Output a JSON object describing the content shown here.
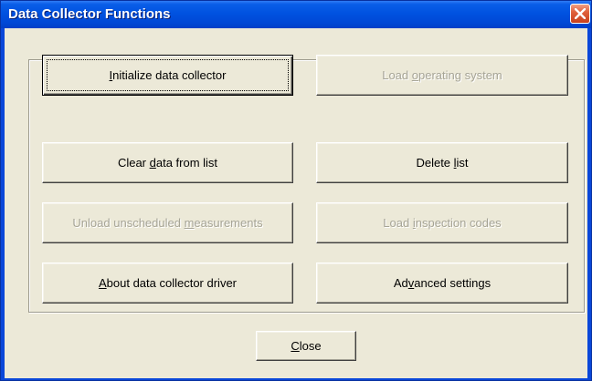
{
  "window": {
    "title": "Data Collector Functions"
  },
  "buttons": {
    "initialize": {
      "pre": "",
      "u": "I",
      "post": "nitialize data collector",
      "enabled": true
    },
    "load_os": {
      "pre": "Load ",
      "u": "o",
      "post": "perating system",
      "enabled": false
    },
    "clear_data": {
      "pre": "Clear ",
      "u": "d",
      "post": "ata from list",
      "enabled": true
    },
    "delete_list": {
      "pre": "Delete ",
      "u": "l",
      "post": "ist",
      "enabled": true
    },
    "unload": {
      "pre": "Unload unscheduled ",
      "u": "m",
      "post": "easurements",
      "enabled": false
    },
    "load_inspection": {
      "pre": "Load ",
      "u": "i",
      "post": "nspection codes",
      "enabled": false
    },
    "about": {
      "pre": "",
      "u": "A",
      "post": "bout data collector driver",
      "enabled": true
    },
    "advanced": {
      "pre": "Ad",
      "u": "v",
      "post": "anced settings",
      "enabled": true
    },
    "close": {
      "pre": "",
      "u": "C",
      "post": "lose",
      "enabled": true
    }
  },
  "icons": {
    "close": "close-x-icon"
  }
}
